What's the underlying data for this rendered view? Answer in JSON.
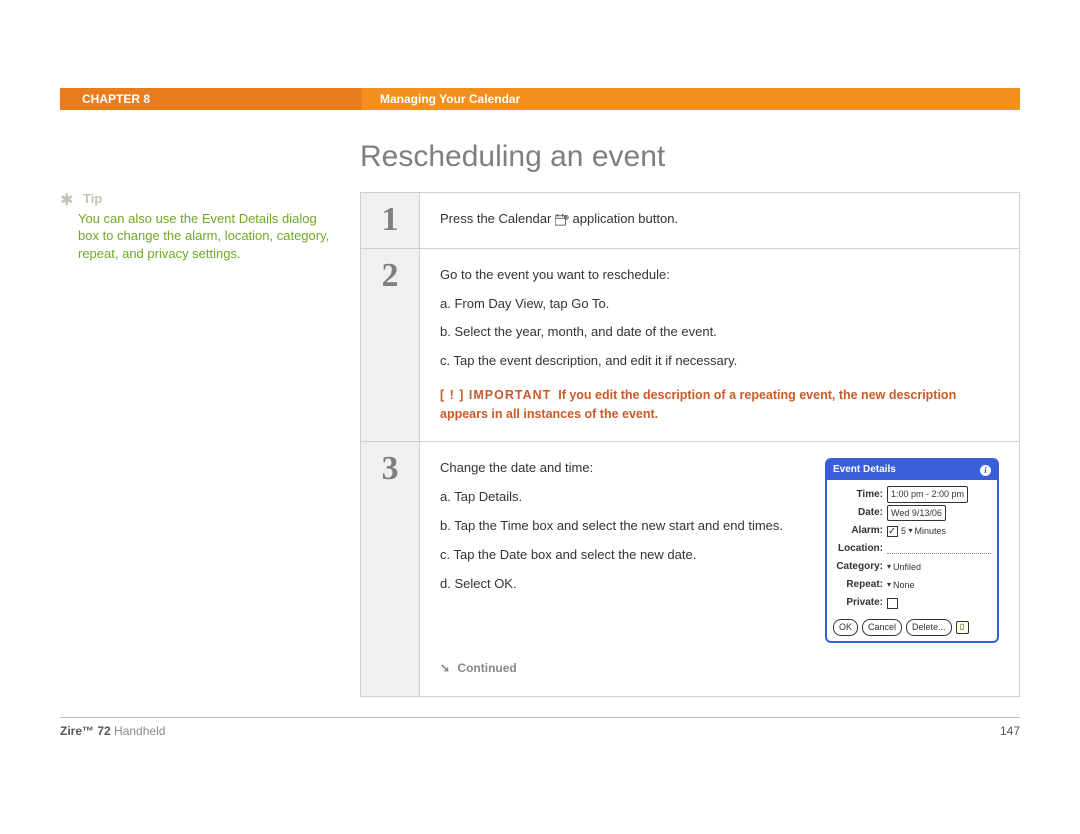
{
  "header": {
    "chapter": "CHAPTER 8",
    "section": "Managing Your Calendar"
  },
  "title": "Rescheduling an event",
  "tip": {
    "label": "Tip",
    "text": "You can also use the Event Details dialog box to change the alarm, location, category, repeat, and privacy settings."
  },
  "steps": [
    {
      "num": "1",
      "intro_a": "Press the Calendar ",
      "intro_b": " application button."
    },
    {
      "num": "2",
      "intro": "Go to the event you want to reschedule:",
      "items": [
        "a.  From Day View, tap Go To.",
        "b.  Select the year, month, and date of the event.",
        "c.  Tap the event description, and edit it if necessary."
      ],
      "important_label": "[ ! ] IMPORTANT",
      "important_text": "If you edit the description of a repeating event, the new description appears in all instances of the event."
    },
    {
      "num": "3",
      "intro": "Change the date and time:",
      "items": [
        "a.  Tap Details.",
        "b.  Tap the Time box and select the new start and end times.",
        "c.  Tap the Date box and select the new date.",
        "d.  Select OK."
      ],
      "continued": "Continued"
    }
  ],
  "event_details": {
    "title": "Event Details",
    "time_label": "Time:",
    "time_value": "1:00 pm - 2:00 pm",
    "date_label": "Date:",
    "date_value": "Wed 9/13/06",
    "alarm_label": "Alarm:",
    "alarm_value": "5",
    "alarm_unit": "Minutes",
    "location_label": "Location:",
    "category_label": "Category:",
    "category_value": "Unfiled",
    "repeat_label": "Repeat:",
    "repeat_value": "None",
    "private_label": "Private:",
    "ok": "OK",
    "cancel": "Cancel",
    "delete": "Delete..."
  },
  "footer": {
    "product_bold": "Zire™ 72",
    "product_rest": "Handheld",
    "page": "147"
  }
}
